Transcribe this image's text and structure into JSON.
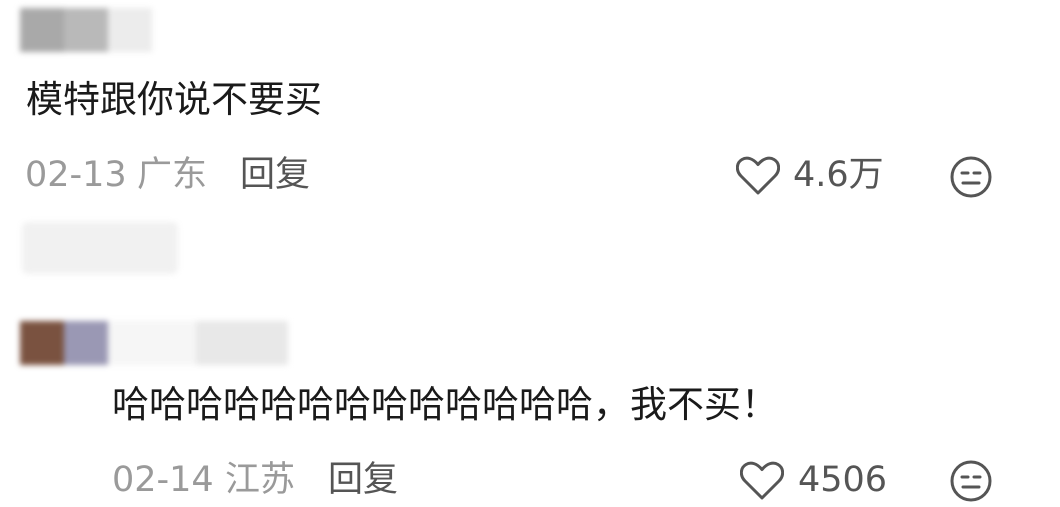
{
  "comments": [
    {
      "text": "模特跟你说不要买",
      "date": "02-13",
      "location": "广东",
      "reply_label": "回复",
      "likes": "4.6万",
      "avatar_colors": [
        "#a9a9a9",
        "#bdbdbd",
        "#ececec"
      ]
    },
    {
      "text": "哈哈哈哈哈哈哈哈哈哈哈哈哈，我不买！",
      "date": "02-14",
      "location": "江苏",
      "reply_label": "回复",
      "likes": "4506",
      "avatar_colors": [
        "#7a5240",
        "#9a98b4",
        "#f2f2f2"
      ]
    }
  ],
  "colors": {
    "text": "#1a1a1a",
    "meta": "#9a9a9a",
    "action": "#555555",
    "icon": "#555555"
  }
}
